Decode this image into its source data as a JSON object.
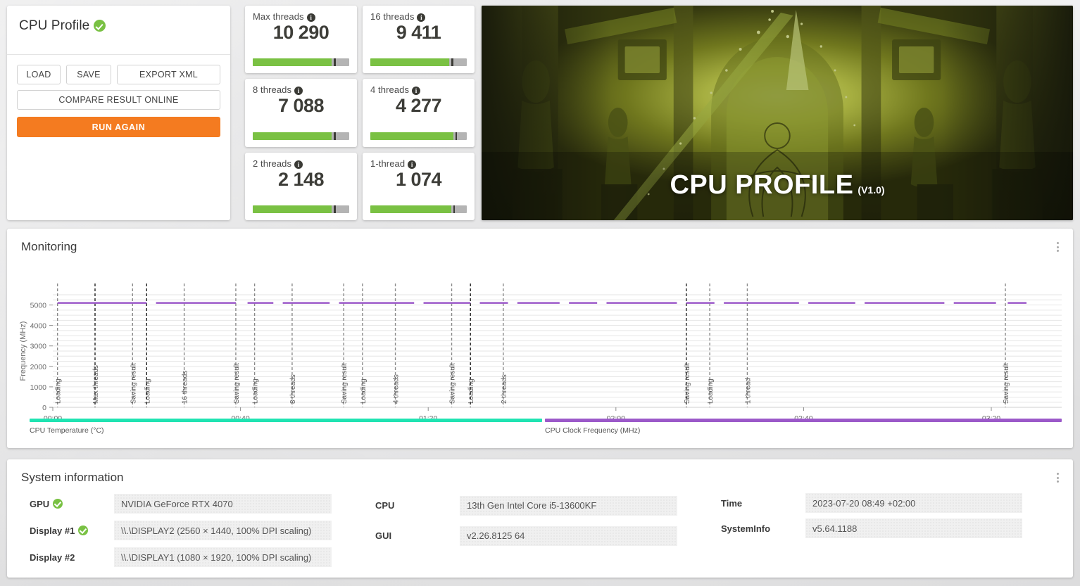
{
  "panel": {
    "title": "CPU Profile",
    "status_icon": "green-check-badge",
    "buttons": {
      "load": "LOAD",
      "save": "SAVE",
      "export_xml": "EXPORT XML",
      "compare": "COMPARE RESULT ONLINE",
      "run_again": "RUN AGAIN"
    }
  },
  "scores": [
    {
      "label": "Max threads",
      "value": "10 290",
      "info_icon": "info-icon",
      "fill_pct": 82,
      "mark_pct": 84
    },
    {
      "label": "16 threads",
      "value": "9 411",
      "info_icon": "info-icon",
      "fill_pct": 82,
      "mark_pct": 84
    },
    {
      "label": "8 threads",
      "value": "7 088",
      "info_icon": "info-icon",
      "fill_pct": 82,
      "mark_pct": 84
    },
    {
      "label": "4 threads",
      "value": "4 277",
      "info_icon": "info-icon",
      "fill_pct": 86,
      "mark_pct": 88
    },
    {
      "label": "2 threads",
      "value": "2 148",
      "info_icon": "info-icon",
      "fill_pct": 82,
      "mark_pct": 84
    },
    {
      "label": "1-thread",
      "value": "1 074",
      "info_icon": "info-icon",
      "fill_pct": 84,
      "mark_pct": 86
    }
  ],
  "hero": {
    "title": "CPU PROFILE",
    "version": "(V1.0)"
  },
  "monitoring": {
    "title": "Monitoring",
    "menu_icon": "kebab-menu-icon",
    "legend": [
      {
        "label": "CPU Temperature (°C)",
        "color": "#20e3b2"
      },
      {
        "label": "CPU Clock Frequency (MHz)",
        "color": "#9b59c9"
      }
    ]
  },
  "chart_data": {
    "type": "line",
    "title": "Monitoring",
    "xlabel": "",
    "ylabel": "Frequency (MHz)",
    "ylim": [
      0,
      5500
    ],
    "yticks": [
      0,
      1000,
      2000,
      3000,
      4000,
      5000
    ],
    "xlim_seconds": [
      0,
      215
    ],
    "xticks": [
      "00:00",
      "00:40",
      "01:20",
      "02:00",
      "02:40",
      "03:20"
    ],
    "xtick_seconds": [
      0,
      40,
      80,
      120,
      160,
      200
    ],
    "grid": true,
    "legend_position": "bottom",
    "series": [
      {
        "name": "CPU Clock Frequency (MHz)",
        "color": "#9b59c9",
        "unit": "MHz",
        "approx_constant_value": 5100,
        "x_seconds": [
          1,
          5,
          10,
          15,
          20,
          25,
          30,
          35,
          40,
          45,
          50,
          55,
          60,
          65,
          70,
          75,
          80,
          85,
          90,
          95,
          100,
          105,
          110,
          115,
          120,
          125,
          130,
          135,
          140,
          145,
          150,
          155,
          160,
          165,
          170,
          175,
          180,
          185,
          190,
          195,
          200,
          205,
          210
        ],
        "values": [
          5100,
          5100,
          5100,
          5100,
          5100,
          5100,
          5100,
          5100,
          5100,
          5100,
          5100,
          5100,
          5100,
          5100,
          5100,
          5100,
          5100,
          5100,
          5100,
          5100,
          5100,
          5100,
          5100,
          5100,
          5100,
          5100,
          5100,
          5100,
          5100,
          5100,
          5100,
          5100,
          5100,
          5100,
          5100,
          5100,
          5100,
          5100,
          5100,
          5100,
          5100,
          5100,
          5100
        ]
      },
      {
        "name": "CPU Temperature (°C)",
        "color": "#20e3b2",
        "unit": "°C",
        "values": []
      }
    ],
    "annotations": [
      {
        "label": "Loading",
        "x_seconds": 1,
        "style": "dashed-gray"
      },
      {
        "label": "Max threads",
        "x_seconds": 9,
        "style": "dashed-black"
      },
      {
        "label": "Saving result",
        "x_seconds": 17,
        "style": "dashed-gray"
      },
      {
        "label": "Loading",
        "x_seconds": 20,
        "style": "dashed-black"
      },
      {
        "label": "16 threads",
        "x_seconds": 28,
        "style": "dashed-gray"
      },
      {
        "label": "Saving result",
        "x_seconds": 39,
        "style": "dashed-gray"
      },
      {
        "label": "Loading",
        "x_seconds": 43,
        "style": "dashed-gray"
      },
      {
        "label": "8 threads",
        "x_seconds": 51,
        "style": "dashed-gray"
      },
      {
        "label": "Saving result",
        "x_seconds": 62,
        "style": "dashed-gray"
      },
      {
        "label": "Loading",
        "x_seconds": 66,
        "style": "dashed-gray"
      },
      {
        "label": "4 threads",
        "x_seconds": 73,
        "style": "dashed-gray"
      },
      {
        "label": "Saving result",
        "x_seconds": 85,
        "style": "dashed-gray"
      },
      {
        "label": "Loading",
        "x_seconds": 89,
        "style": "dashed-black"
      },
      {
        "label": "2 threads",
        "x_seconds": 96,
        "style": "dashed-gray"
      },
      {
        "label": "Saving result",
        "x_seconds": 135,
        "style": "dashed-black"
      },
      {
        "label": "Loading",
        "x_seconds": 140,
        "style": "dashed-gray"
      },
      {
        "label": "1 thread",
        "x_seconds": 148,
        "style": "dashed-gray"
      },
      {
        "label": "Saving result",
        "x_seconds": 203,
        "style": "dashed-gray"
      }
    ]
  },
  "system_information": {
    "title": "System information",
    "menu_icon": "kebab-menu-icon",
    "columns": [
      [
        {
          "key": "GPU",
          "value": "NVIDIA GeForce RTX 4070",
          "verified": true
        },
        {
          "key": "Display #1",
          "value": "\\\\.\\DISPLAY2 (2560 × 1440, 100% DPI scaling)",
          "verified": true
        },
        {
          "key": "Display #2",
          "value": "\\\\.\\DISPLAY1 (1080 × 1920, 100% DPI scaling)",
          "verified": false
        }
      ],
      [
        {
          "key": "CPU",
          "value": "13th Gen Intel Core i5-13600KF",
          "verified": false
        },
        {
          "key": "GUI",
          "value": "v2.26.8125 64",
          "verified": false
        }
      ],
      [
        {
          "key": "Time",
          "value": "2023-07-20 08:49 +02:00",
          "verified": false
        },
        {
          "key": "SystemInfo",
          "value": "v5.64.1188",
          "verified": false
        }
      ]
    ]
  },
  "colors": {
    "accent_orange": "#f47b20",
    "bar_green": "#7ac143",
    "temp_teal": "#20e3b2",
    "clock_purple": "#9b59c9",
    "check_green": "#79c143"
  }
}
